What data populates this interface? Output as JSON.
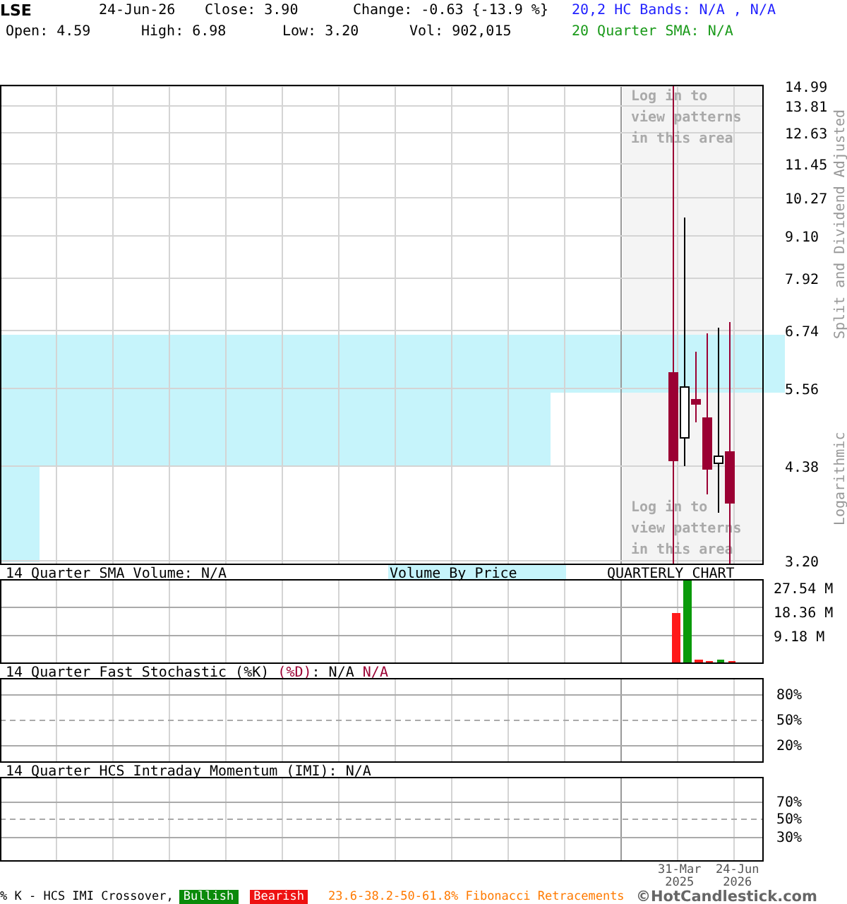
{
  "header": {
    "symbol": "LSE",
    "date": "24-Jun-26",
    "close": "Close: 3.90",
    "change": "Change: -0.63 {-13.9 %}",
    "open": "Open: 4.59",
    "high": "High: 6.98",
    "low": "Low: 3.20",
    "volume": "Vol: 902,015"
  },
  "legend": {
    "hc_bands": "20,2 HC Bands: N/A , N/A",
    "sma": "20 Quarter SMA: N/A"
  },
  "price_chart": {
    "yticks": [
      "14.99",
      "13.81",
      "12.63",
      "11.45",
      "10.27",
      "9.10",
      "7.92",
      "6.74",
      "5.56",
      "4.38",
      "3.20"
    ],
    "side_labels": [
      "Split and Dividend Adjusted",
      "Logarithmic"
    ],
    "pattern_notices": [
      [
        "Log in to",
        "view patterns",
        "in this area"
      ],
      [
        "Log in to",
        "view patterns",
        "in this area"
      ]
    ]
  },
  "volume_panel": {
    "title": "14 Quarter SMA Volume: N/A",
    "volume_by_price": "Volume By Price",
    "period": "QUARTERLY CHART",
    "yticks": [
      "27.54 M",
      "18.36 M",
      "9.18 M"
    ]
  },
  "stochastic_panel": {
    "title": "14 Quarter Fast Stochastic (%K)",
    "d_label": "(%D)",
    "k_value": ": N/A",
    "d_value": "N/A",
    "yticks": [
      "80%",
      "50%",
      "20%"
    ]
  },
  "momentum_panel": {
    "title": "14 Quarter HCS Intraday Momentum (IMI): N/A",
    "yticks": [
      "70%",
      "50%",
      "30%"
    ]
  },
  "dates": [
    {
      "day": "31-Mar",
      "year": "2025"
    },
    {
      "day": "24-Jun",
      "year": "2026"
    }
  ],
  "footer": {
    "crossover": "% K - HCS IMI Crossover,",
    "bullish": "Bullish",
    "bearish": "Bearish",
    "fibonacci": "23.6-38.2-50-61.8% Fibonacci Retracements",
    "brand": "©HotCandlestick.com"
  }
}
